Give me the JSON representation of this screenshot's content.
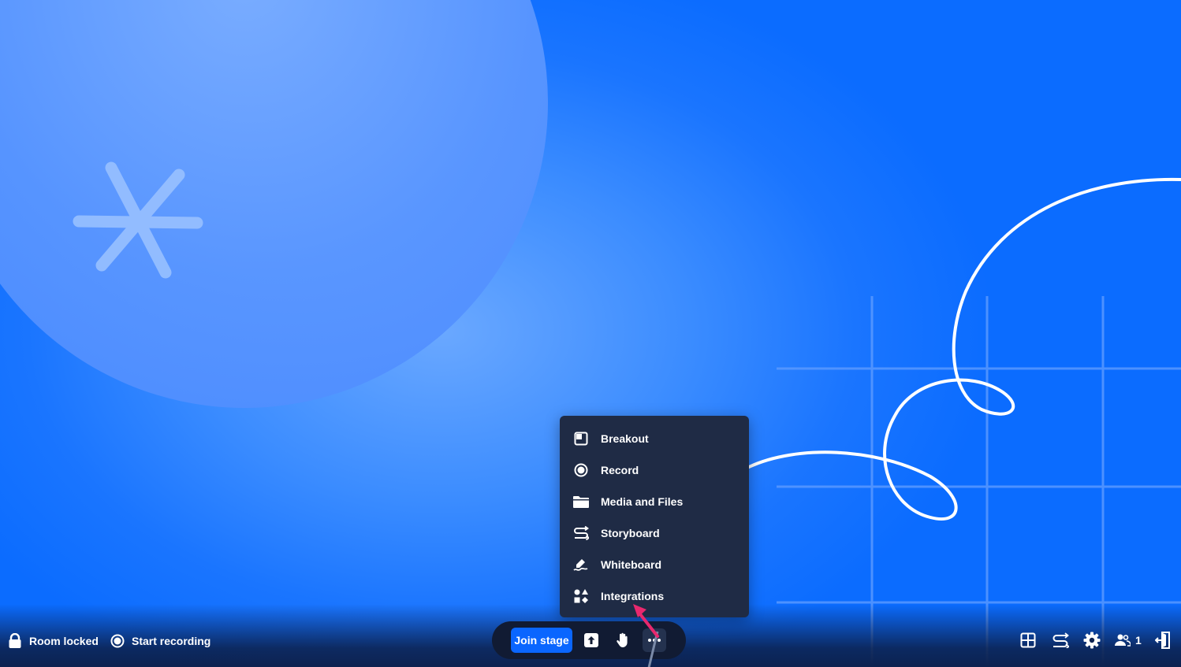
{
  "colors": {
    "accent": "#0a66ff",
    "menu_bg": "#1f2b45",
    "toolbar_bg": "#111b33",
    "cursor_arrow": "#e8286e"
  },
  "status": {
    "room_locked": "Room locked",
    "start_recording": "Start recording"
  },
  "toolbar": {
    "join_stage": "Join stage",
    "icons": [
      "share-screen-icon",
      "raise-hand-icon",
      "more-options-icon"
    ]
  },
  "menu": {
    "items": [
      {
        "label": "Breakout",
        "icon": "breakout-icon"
      },
      {
        "label": "Record",
        "icon": "record-icon"
      },
      {
        "label": "Media and Files",
        "icon": "folder-icon"
      },
      {
        "label": "Storyboard",
        "icon": "storyboard-icon"
      },
      {
        "label": "Whiteboard",
        "icon": "whiteboard-icon"
      },
      {
        "label": "Integrations",
        "icon": "integrations-icon"
      }
    ]
  },
  "right_controls": {
    "icons": [
      "layout-grid-icon",
      "storyboard-icon",
      "settings-gear-icon",
      "participants-icon",
      "leave-room-icon"
    ],
    "participant_count": "1"
  }
}
